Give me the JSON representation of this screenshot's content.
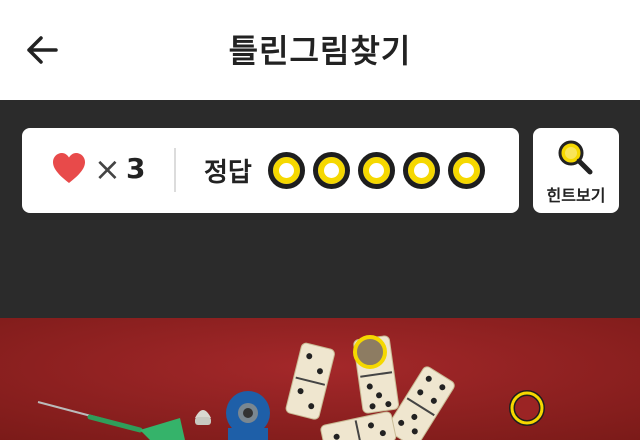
{
  "header": {
    "title": "틀린그림찾기",
    "back_icon": "arrow-left-icon"
  },
  "status": {
    "lives_symbol": "×",
    "lives": "3",
    "answer_label": "정답",
    "answers_found": 0,
    "answers_total": 5,
    "heart_color": "#e84a4a",
    "ring_color": "#f5d800"
  },
  "hint": {
    "label": "힌트보기",
    "icon": "magnifier-icon"
  },
  "colors": {
    "header_bg": "#ffffff",
    "band_bg": "#2b2b2b",
    "photo_bg": "#8d1f1d"
  }
}
